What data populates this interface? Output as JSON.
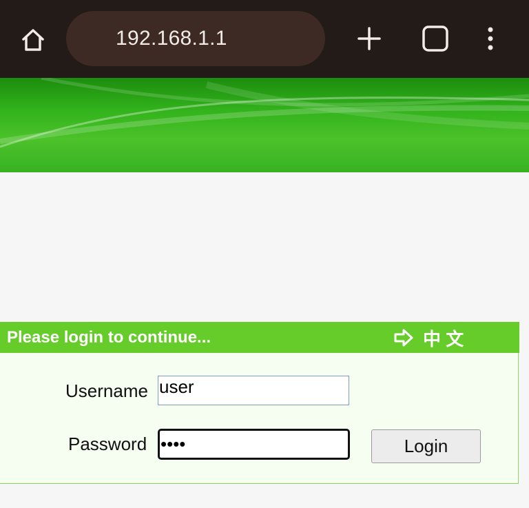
{
  "browser": {
    "url": "192.168.1.1",
    "icons": [
      "home-icon",
      "plus-icon",
      "tabs-icon",
      "more-vert-icon"
    ]
  },
  "login": {
    "header_title": "Please login to continue...",
    "language_link": "中 文",
    "language_icon": "arrow-right-icon",
    "username_label": "Username",
    "username_value": "user",
    "password_label": "Password",
    "password_value": "••••",
    "login_button": "Login"
  },
  "colors": {
    "toolbar": "#231b17",
    "address_bar": "#3d2a24",
    "banner_green": "#38b222",
    "login_header": "#66cc2a",
    "login_body": "#f6fdf1",
    "page_background": "#f6f6f6"
  }
}
